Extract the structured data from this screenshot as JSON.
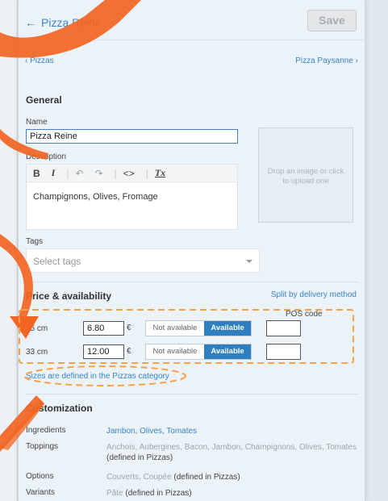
{
  "header": {
    "back_arrow": "←",
    "title": "Pizza Reine",
    "save_label": "Save"
  },
  "breadcrumbs": {
    "prev": "‹ Pizzas",
    "next": "Pizza Paysanne ›"
  },
  "general": {
    "heading": "General",
    "name_label": "Name",
    "name_value": "Pizza Reine",
    "description_label": "Description",
    "toolbar": {
      "bold": "B",
      "italic": "I",
      "undo": "↶",
      "redo": "↷",
      "code": "<>",
      "clear": "Tx"
    },
    "description_value": "Champignons, Olives, Fromage",
    "dropzone_text": "Drop an image or click to upload one",
    "tags_label": "Tags",
    "tags_placeholder": "Select tags"
  },
  "pricing": {
    "heading": "Price & availability",
    "split_link": "Split by delivery method",
    "pos_code_label": "POS code",
    "currency": "€",
    "sizes": [
      {
        "name": "25 cm",
        "price": "6.80",
        "not_available": "Not available",
        "available": "Available",
        "pos_code": ""
      },
      {
        "name": "33 cm",
        "price": "12.00",
        "not_available": "Not available",
        "available": "Available",
        "pos_code": ""
      }
    ],
    "sizes_note": "Sizes are defined in the Pizzas category"
  },
  "customization": {
    "heading": "Customization",
    "rows": [
      {
        "key": "Ingredients",
        "value": "Jambon, Olives, Tomates"
      },
      {
        "key": "Toppings",
        "value": "Anchois, Aubergines, Bacon, Jambon, Champignons, Olives, Tomates",
        "suffix": "(defined in Pizzas)"
      },
      {
        "key": "Options",
        "value": "Couverts, Coupée",
        "suffix": "(defined in Pizzas)"
      },
      {
        "key": "Variants",
        "value": "Pâte",
        "suffix": "(defined in Pizzas)"
      }
    ]
  },
  "colors": {
    "annotation": "#f26522",
    "link": "#3b83c4",
    "available": "#2e7fc2"
  }
}
